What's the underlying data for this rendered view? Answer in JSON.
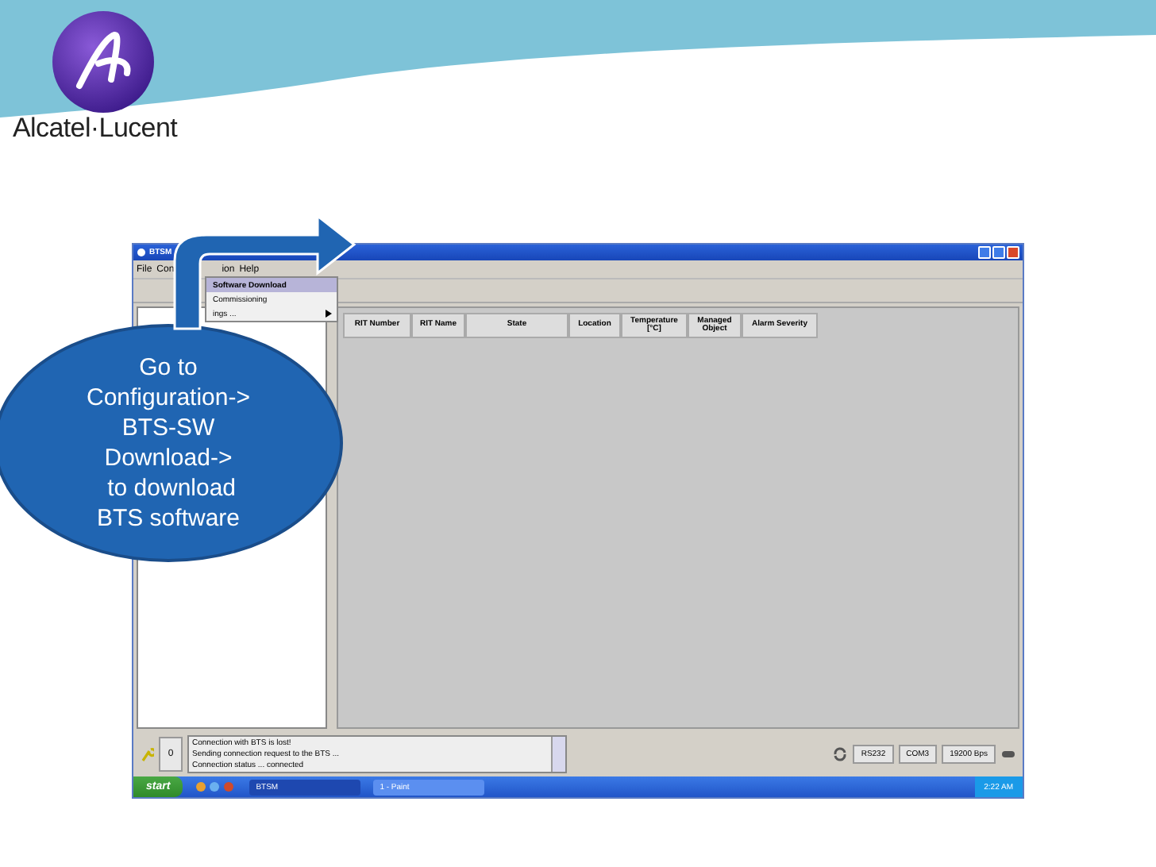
{
  "logo": {
    "brand": "Alcatel·Lucent"
  },
  "window": {
    "title": "BTSM",
    "menu": [
      "File",
      "Con",
      "ion",
      "Help"
    ],
    "dropdown": [
      {
        "label": "Software Download",
        "selected": true,
        "submenu": false
      },
      {
        "label": "Commissioning",
        "selected": false,
        "submenu": false
      },
      {
        "label": "ings ...",
        "selected": false,
        "submenu": true
      }
    ],
    "table": {
      "columns": [
        "RIT Number",
        "RIT Name",
        "State",
        "Location",
        "Temperature [°C]",
        "Managed Object",
        "Alarm Severity"
      ]
    },
    "status": {
      "count": "0",
      "messages": [
        "Connection with BTS is lost!",
        "Sending connection request to the BTS ...",
        "Connection status ... connected"
      ],
      "fields": [
        "RS232",
        "COM3",
        "19200 Bps"
      ]
    },
    "taskbar": {
      "start": "start",
      "tasks": [
        {
          "label": "BTSM",
          "selected": false
        },
        {
          "label": "1 - Paint",
          "selected": true
        }
      ],
      "clock": "2:22 AM"
    }
  },
  "callout": {
    "lines": [
      "Go to",
      "Configuration->",
      "BTS-SW",
      "Download->",
      " to download",
      "BTS software"
    ]
  }
}
